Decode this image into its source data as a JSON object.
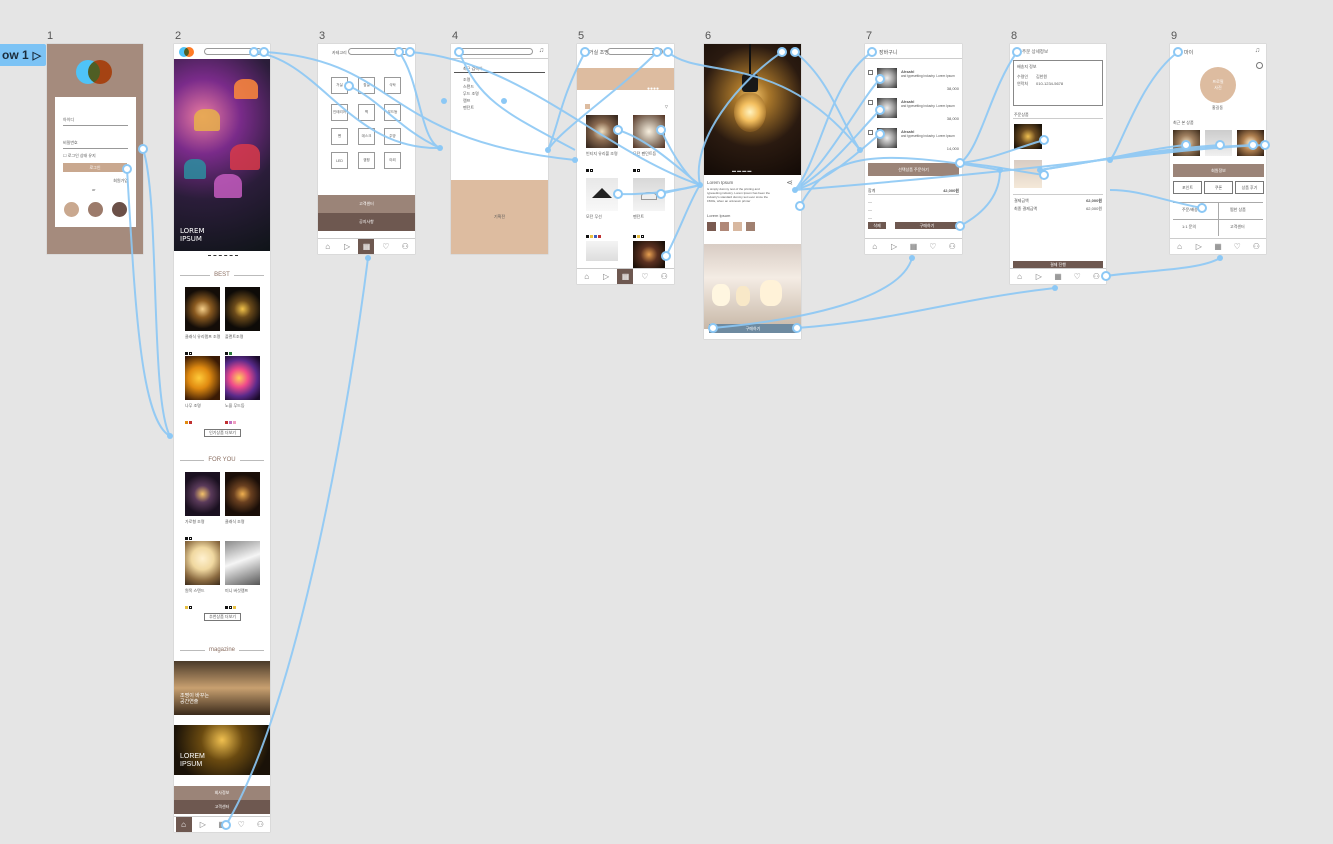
{
  "flow": {
    "label": "ow 1"
  },
  "frames": [
    {
      "num": "1"
    },
    {
      "num": "2"
    },
    {
      "num": "3"
    },
    {
      "num": "4"
    },
    {
      "num": "5"
    },
    {
      "num": "6"
    },
    {
      "num": "7"
    },
    {
      "num": "8"
    },
    {
      "num": "9"
    }
  ],
  "login": {
    "id_label": "아이디",
    "pw_label": "비밀번호",
    "auto_login": "로그인 상태 유지",
    "login_button": "로그인",
    "signup": "회원가입",
    "or": "or"
  },
  "home": {
    "hero_title": "LOREM\nIPSUM",
    "best_title": "BEST",
    "best_items": [
      "클래식 유리램프 조명",
      "플랜트조명",
      "나무 조명",
      "노을 무드등"
    ],
    "best_more": "인기상품 더보기",
    "foryou_title": "FOR YOU",
    "foryou_items": [
      "가로형 조명",
      "클래식 조명",
      "원목 스탠드",
      "미니 버섯램프"
    ],
    "foryou_more": "추천상품 더보기",
    "magazine_title": "magazine",
    "mag1": "조명이 바꾸는\n공간연출",
    "mag2": "LOREM\nIPSUM",
    "footer1": "회사정보",
    "footer2": "고객센터"
  },
  "category": {
    "title": "카테고리",
    "cells": [
      "거실",
      "침실",
      "식탁",
      "인테리어",
      "벽",
      "무드등",
      "펜",
      "데스크",
      "주방",
      "LED",
      "캠핑",
      "야외"
    ],
    "bar1": "고객센터",
    "bar2": "공지사항"
  },
  "search": {
    "hint": "최근 검색어",
    "items": [
      "조명",
      "스탠드",
      "무드 조명",
      "램프",
      "펜던트"
    ],
    "banner": "기획전"
  },
  "list": {
    "title": "거실 조명",
    "items": [
      "라탄 샹들리에 조명",
      "모던 펜던트",
      "빈티지 유리볼 조명",
      "모던 펜던트등",
      "모던 무선",
      "펜던트"
    ]
  },
  "detail": {
    "name": "Lorem Ipsum",
    "desc": "is simply dummy text of the printing and typesetting industry. Lorem Ipsum has been the industry's standard dummy text ever since the 1500s, when an unknown printer",
    "option": "Lorem Ipsum",
    "cart_btn": "구매하기"
  },
  "cart": {
    "title": "장바구니",
    "items": [
      {
        "name": "Ahsahl",
        "desc": "and typesetting industry. Lorem Ipsum",
        "price": "38,000"
      },
      {
        "name": "Ahsahl",
        "desc": "and typesetting industry. Lorem Ipsum",
        "price": "38,000"
      },
      {
        "name": "Ahsahl",
        "desc": "and typesetting industry. Lorem Ipsum",
        "price": "14,000"
      }
    ],
    "order_btn": "선택상품 주문하기",
    "total_label": "합계",
    "total": "42,000원",
    "pay_btn": "구매하기",
    "del_btn": "삭제"
  },
  "order": {
    "title": "주문 상세정보",
    "section1": "배송지 정보",
    "name_label": "수령인",
    "name_value": "김한원",
    "phone_label": "연락처",
    "phone_value": "010-1234-5678",
    "section2": "주문상품",
    "pay_section": "결제금액",
    "pay_total": "62,000원",
    "final_label": "최종 결제금액",
    "final_value": "62,000원",
    "pay_btn": "결제 진행"
  },
  "mypage": {
    "title": "마이",
    "profile": "프로필\n사진",
    "user": "홍길동",
    "recent": "최근 본 상품",
    "edit_btn": "회원정보",
    "stats": [
      "포인트",
      "쿠폰",
      "상품 후기"
    ],
    "menu": [
      "주문/배송",
      "찜한 상품",
      "1:1 문의",
      "고객센터"
    ]
  }
}
